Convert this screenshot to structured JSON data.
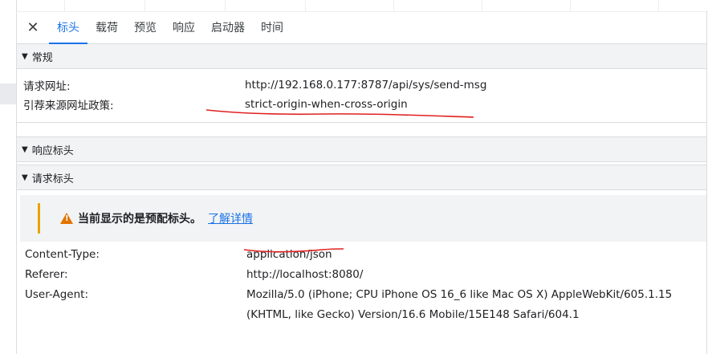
{
  "tabs": {
    "close_icon": "close-icon",
    "items": [
      "标头",
      "载荷",
      "预览",
      "响应",
      "启动器",
      "时间"
    ],
    "active_index": 0
  },
  "general": {
    "title": "常规",
    "rows": [
      {
        "key": "请求网址:",
        "value": "http://192.168.0.177:8787/api/sys/send-msg"
      },
      {
        "key": "引荐来源网址政策:",
        "value": "strict-origin-when-cross-origin"
      }
    ]
  },
  "response_headers": {
    "title": "响应标头"
  },
  "request_headers": {
    "title": "请求标头",
    "warning_text": "当前显示的是预配标头。",
    "warning_link": "了解详情",
    "rows": [
      {
        "key": "Content-Type:",
        "value": "application/json"
      },
      {
        "key": "Referer:",
        "value": "http://localhost:8080/"
      },
      {
        "key": "User-Agent:",
        "value": "Mozilla/5.0 (iPhone; CPU iPhone OS 16_6 like Mac OS X) AppleWebKit/605.1.15 (KHTML, like Gecko) Version/16.6 Mobile/15E148 Safari/604.1"
      }
    ]
  },
  "colors": {
    "accent": "#1a73e8",
    "annotation": "#e02020",
    "warning": "#e37400"
  }
}
